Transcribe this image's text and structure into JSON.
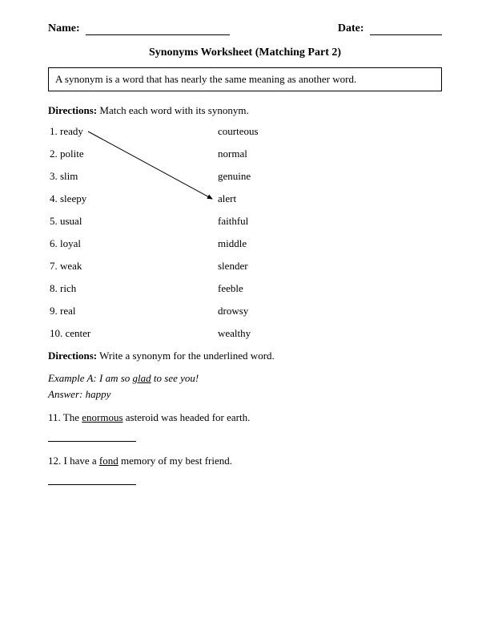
{
  "header": {
    "name_label": "Name:",
    "date_label": "Date:"
  },
  "title": "Synonyms Worksheet (Matching Part 2)",
  "definition": "A synonym is a word that has nearly the same meaning as another word.",
  "directions1_label": "Directions:",
  "directions1_text": " Match each word with its synonym.",
  "matching": {
    "left": [
      "1. ready",
      "2. polite",
      "3. slim",
      "4. sleepy",
      "5. usual",
      "6. loyal",
      "7. weak",
      "8. rich",
      "9. real",
      "10. center"
    ],
    "right": [
      "courteous",
      "normal",
      "genuine",
      "alert",
      "faithful",
      "middle",
      "slender",
      "feeble",
      "drowsy",
      "wealthy"
    ]
  },
  "directions2_label": "Directions:",
  "directions2_text": " Write a synonym for the underlined word.",
  "example": {
    "line1_pre": "Example A: I am so ",
    "line1_u": "glad",
    "line1_post": " to see you!",
    "line2": "Answer: happy"
  },
  "q11": {
    "pre": "11. The ",
    "u": "enormous",
    "post": " asteroid was headed for earth."
  },
  "q12": {
    "pre": "12. I have a ",
    "u": "fond",
    "post": " memory of my best friend."
  }
}
